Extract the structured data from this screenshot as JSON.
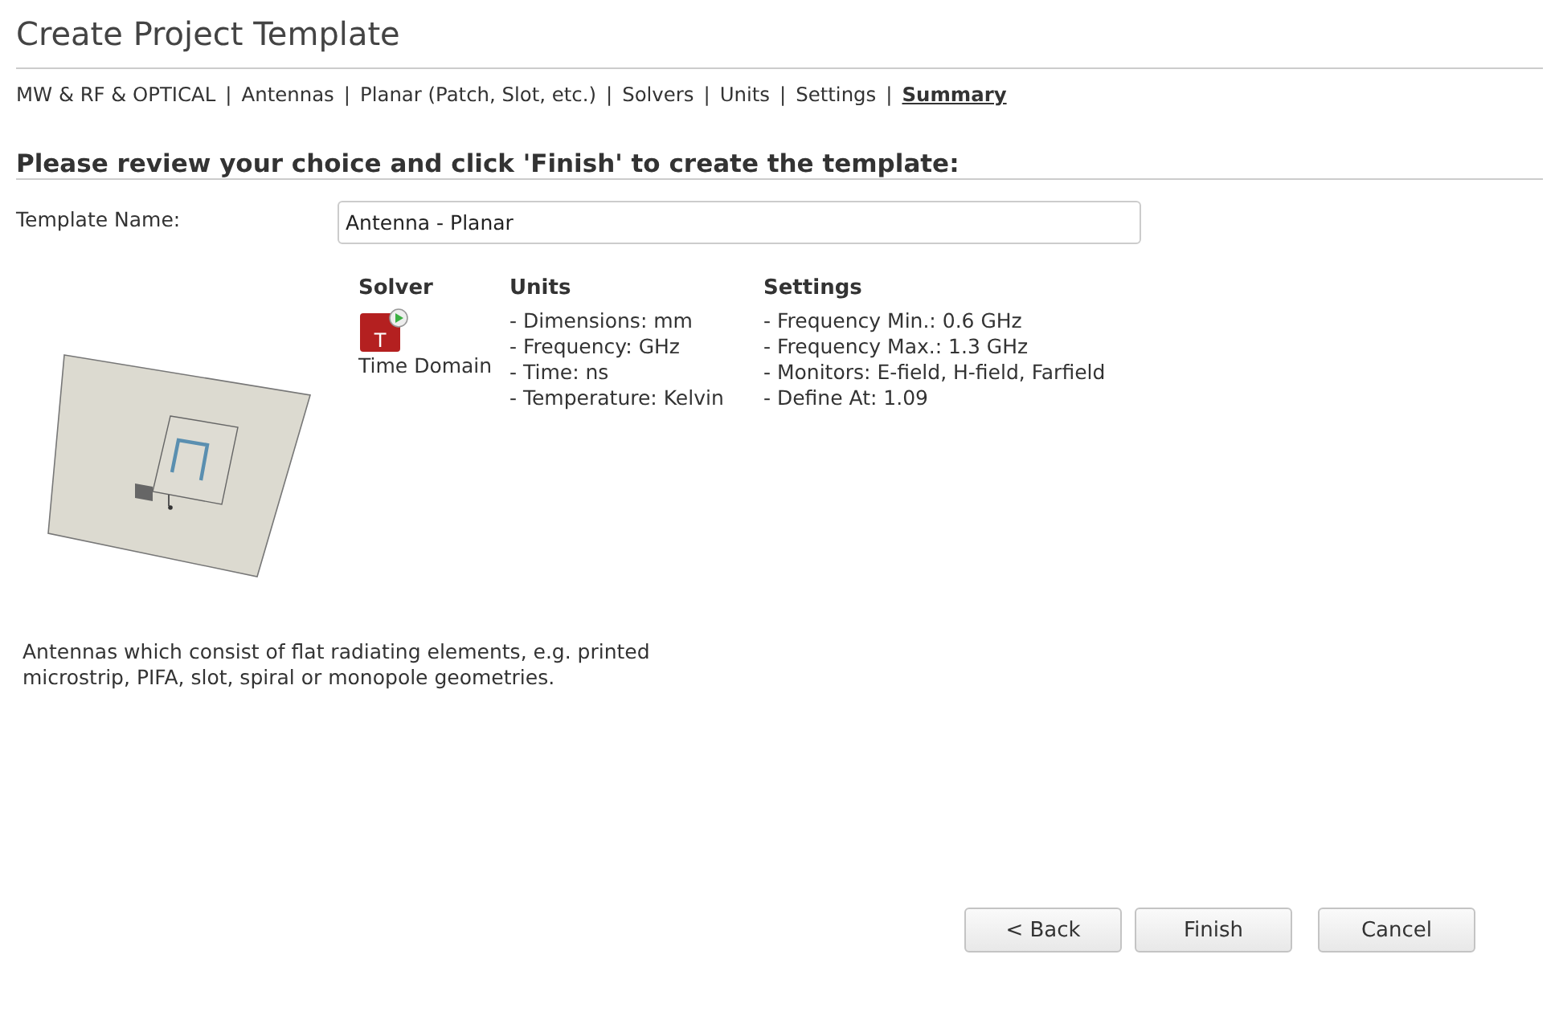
{
  "window": {
    "title": "Create Project Template"
  },
  "breadcrumb": [
    {
      "label": "MW & RF & OPTICAL",
      "selected": false,
      "separator": "|"
    },
    {
      "label": "Antennas",
      "selected": false,
      "separator": "|"
    },
    {
      "label": "Planar (Patch, Slot, etc.)",
      "selected": false,
      "separator": "|"
    },
    {
      "label": "Solvers",
      "selected": false,
      "separator": "|"
    },
    {
      "label": "Units",
      "selected": false,
      "separator": "|"
    },
    {
      "label": "Settings",
      "selected": false,
      "separator": "|"
    },
    {
      "label": "Summary",
      "selected": true
    }
  ],
  "heading": "Please review your choice and click 'Finish' to create the template:",
  "template_name": {
    "label": "Template Name:",
    "value": "Antenna - Planar"
  },
  "summary": {
    "solver": {
      "header": "Solver",
      "icon_letter": "T",
      "name": "Time Domain"
    },
    "units": {
      "header": "Units",
      "items": [
        "- Dimensions: mm",
        "- Frequency: GHz",
        "- Time: ns",
        "- Temperature: Kelvin"
      ]
    },
    "settings": {
      "header": "Settings",
      "items": [
        "- Frequency Min.: 0.6 GHz",
        "- Frequency Max.: 1.3 GHz",
        "- Monitors: E-field, H-field, Farfield",
        "- Define At: 1.09"
      ]
    }
  },
  "description": "Antennas which consist of flat radiating elements, e.g. printed microstrip, PIFA, slot, spiral or monopole geometries.",
  "buttons": [
    {
      "label": "< Back"
    },
    {
      "label": "Finish"
    },
    {
      "label": "Cancel"
    }
  ]
}
